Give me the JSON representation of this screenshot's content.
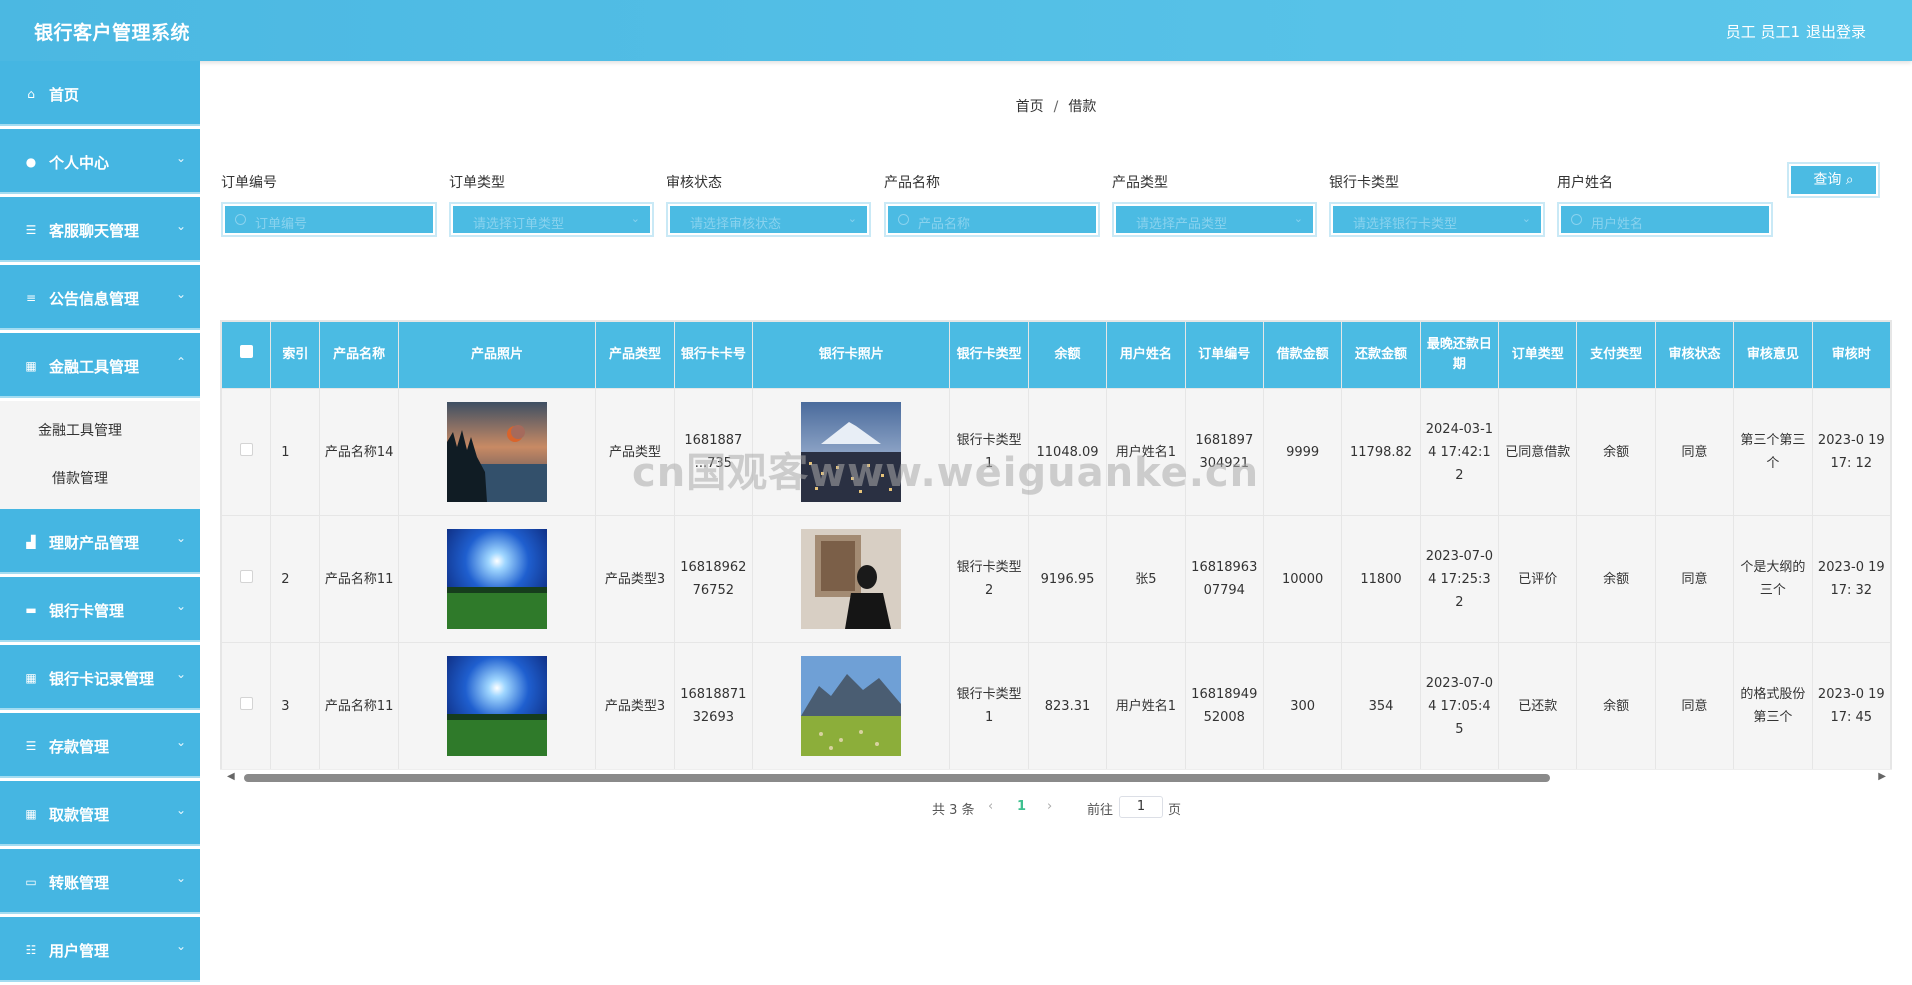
{
  "header": {
    "title": "银行客户管理系统",
    "user": "员工 员工1",
    "logout": "退出登录"
  },
  "sidebar": {
    "items": [
      {
        "label": "首页",
        "icon": "home-icon"
      },
      {
        "label": "个人中心",
        "icon": "user-icon"
      },
      {
        "label": "客服聊天管理",
        "icon": "menu-icon"
      },
      {
        "label": "公告信息管理",
        "icon": "sliders-icon"
      },
      {
        "label": "金融工具管理",
        "icon": "grid-icon"
      },
      {
        "label": "理财产品管理",
        "icon": "chart-icon"
      },
      {
        "label": "银行卡管理",
        "icon": "card-icon"
      },
      {
        "label": "银行卡记录管理",
        "icon": "grid-icon"
      },
      {
        "label": "存款管理",
        "icon": "menu-icon"
      },
      {
        "label": "取款管理",
        "icon": "grid-icon"
      },
      {
        "label": "转账管理",
        "icon": "monitor-icon"
      },
      {
        "label": "用户管理",
        "icon": "users-icon"
      }
    ],
    "submenu": [
      "金融工具管理",
      "借款管理"
    ]
  },
  "breadcrumb": {
    "home": "首页",
    "sep": "/",
    "current": "借款"
  },
  "filters": [
    {
      "label": "订单编号",
      "placeholder": "订单编号",
      "type": "search"
    },
    {
      "label": "订单类型",
      "placeholder": "请选择订单类型",
      "type": "select"
    },
    {
      "label": "审核状态",
      "placeholder": "请选择审核状态",
      "type": "select"
    },
    {
      "label": "产品名称",
      "placeholder": "产品名称",
      "type": "search"
    },
    {
      "label": "产品类型",
      "placeholder": "请选择产品类型",
      "type": "select"
    },
    {
      "label": "银行卡类型",
      "placeholder": "请选择银行卡类型",
      "type": "select"
    },
    {
      "label": "用户姓名",
      "placeholder": "用户姓名",
      "type": "search"
    }
  ],
  "query_button": "查询",
  "table": {
    "columns": [
      "索引",
      "产品名称",
      "产品照片",
      "产品类型",
      "银行卡卡号",
      "银行卡照片",
      "银行卡类型",
      "余额",
      "用户姓名",
      "订单编号",
      "借款金额",
      "还款金额",
      "最晚还款日期",
      "订单类型",
      "支付类型",
      "审核状态",
      "审核意见",
      "审核时"
    ],
    "rows": [
      [
        "1",
        "产品名称14",
        "",
        "产品类型",
        "1681887 ...735",
        "",
        "银行卡类型1",
        "11048.09",
        "用户姓名1",
        "1681897 304921",
        "9999",
        "11798.82",
        "2024-03-14 17:42:12",
        "已同意借款",
        "余额",
        "同意",
        "第三个第三个",
        "2023-0 19 17: 12"
      ],
      [
        "2",
        "产品名称11",
        "",
        "产品类型3",
        "1681896276752",
        "",
        "银行卡类型2",
        "9196.95",
        "张5",
        "1681896307794",
        "10000",
        "11800",
        "2023-07-04 17:25:32",
        "已评价",
        "余额",
        "同意",
        "个是大纲的三个",
        "2023-0 19 17: 32"
      ],
      [
        "3",
        "产品名称11",
        "",
        "产品类型3",
        "1681887132693",
        "",
        "银行卡类型1",
        "823.31",
        "用户姓名1",
        "1681894952008",
        "300",
        "354",
        "2023-07-04 17:05:45",
        "已还款",
        "余额",
        "同意",
        "的格式股份第三个",
        "2023-0 19 17: 45"
      ]
    ]
  },
  "pagination": {
    "total": "共 3 条",
    "current": "1",
    "goto": "前往",
    "page_input": "1",
    "page_suffix": "页"
  },
  "watermark": "cn国观客www.weiguanke.cn",
  "colors": {
    "primary": "#4bbbe3",
    "header": "#4bb8e2",
    "white": "#ffffff"
  }
}
